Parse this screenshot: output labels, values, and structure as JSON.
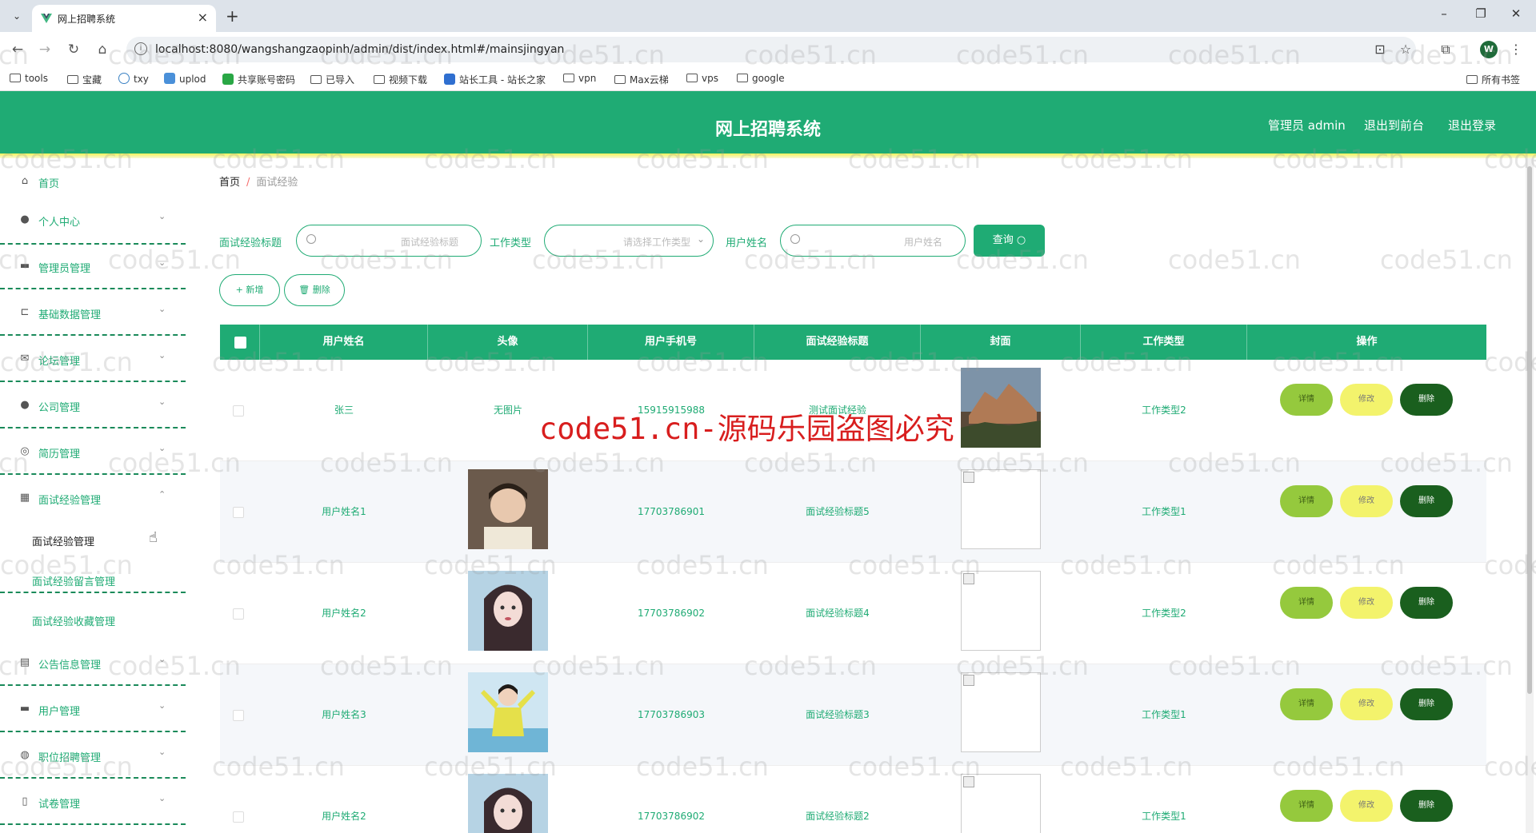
{
  "browser": {
    "tab_title": "网上招聘系统",
    "url": "localhost:8080/wangshangzaopinh/admin/dist/index.html#/mainsjingyan",
    "profile_letter": "W",
    "bookmarks": [
      "tools",
      "宝藏",
      "txy",
      "uplod",
      "共享账号密码",
      "已导入",
      "视频下载",
      "站长工具 - 站长之家",
      "vpn",
      "Max云梯",
      "vps",
      "google"
    ],
    "all_bookmarks": "所有书签"
  },
  "header": {
    "title": "网上招聘系统",
    "admin": "管理员 admin",
    "front": "退出到前台",
    "logout": "退出登录"
  },
  "sidebar": {
    "items": [
      {
        "label": "首页",
        "icon": "home-icon"
      },
      {
        "label": "个人中心",
        "icon": "user-icon"
      },
      {
        "label": "管理员管理",
        "icon": "admin-icon"
      },
      {
        "label": "基础数据管理",
        "icon": "crop-icon"
      },
      {
        "label": "论坛管理",
        "icon": "mail-icon"
      },
      {
        "label": "公司管理",
        "icon": "user-icon"
      },
      {
        "label": "简历管理",
        "icon": "circle-icon"
      },
      {
        "label": "面试经验管理",
        "icon": "grid-icon"
      },
      {
        "label": "公告信息管理",
        "icon": "notice-icon"
      },
      {
        "label": "用户管理",
        "icon": "monitor-icon"
      },
      {
        "label": "职位招聘管理",
        "icon": "globe-icon"
      },
      {
        "label": "试卷管理",
        "icon": "phone-icon"
      }
    ],
    "submenu": [
      "面试经验管理",
      "面试经验留言管理",
      "面试经验收藏管理"
    ]
  },
  "breadcrumb": {
    "home": "首页",
    "current": "面试经验"
  },
  "filters": {
    "title_label": "面试经验标题",
    "title_placeholder": "面试经验标题",
    "type_label": "工作类型",
    "type_placeholder": "请选择工作类型",
    "user_label": "用户姓名",
    "user_placeholder": "用户姓名",
    "search_btn": "查询",
    "add_btn": "新增",
    "delete_btn": "删除"
  },
  "table": {
    "headers": [
      "用户姓名",
      "头像",
      "用户手机号",
      "面试经验标题",
      "封面",
      "工作类型",
      "操作"
    ],
    "actions": {
      "detail": "详情",
      "edit": "修改",
      "delete": "删除"
    },
    "rows": [
      {
        "name": "张三",
        "avatar": "无图片",
        "phone": "15915915988",
        "title": "测试面试经验",
        "type": "工作类型2"
      },
      {
        "name": "用户姓名1",
        "avatar": "",
        "phone": "17703786901",
        "title": "面试经验标题5",
        "type": "工作类型1"
      },
      {
        "name": "用户姓名2",
        "avatar": "",
        "phone": "17703786902",
        "title": "面试经验标题4",
        "type": "工作类型2"
      },
      {
        "name": "用户姓名3",
        "avatar": "",
        "phone": "17703786903",
        "title": "面试经验标题3",
        "type": "工作类型1"
      },
      {
        "name": "用户姓名2",
        "avatar": "",
        "phone": "17703786902",
        "title": "面试经验标题2",
        "type": "工作类型1"
      }
    ]
  },
  "watermark": "code51.cn",
  "watermark_red": "code51.cn-源码乐园盗图必究",
  "colors": {
    "primary": "#1fab74",
    "stripe": "#f2f25a",
    "detail": "#95c93d",
    "edit": "#f3f36c",
    "delete": "#1a5f1e"
  }
}
